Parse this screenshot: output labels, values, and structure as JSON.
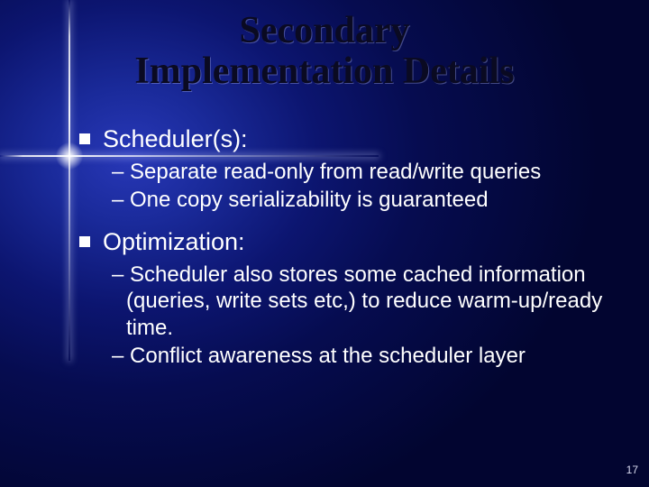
{
  "title_line1": "Secondary",
  "title_line2": "Implementation Details",
  "sections": [
    {
      "heading": "Scheduler(s):",
      "items": [
        "– Separate read-only from read/write queries",
        "– One copy serializability is guaranteed"
      ]
    },
    {
      "heading": "Optimization:",
      "items": [
        "– Scheduler also stores some cached information (queries, write sets etc,) to reduce warm-up/ready time.",
        "– Conflict awareness at the scheduler layer"
      ]
    }
  ],
  "page_number": "17"
}
